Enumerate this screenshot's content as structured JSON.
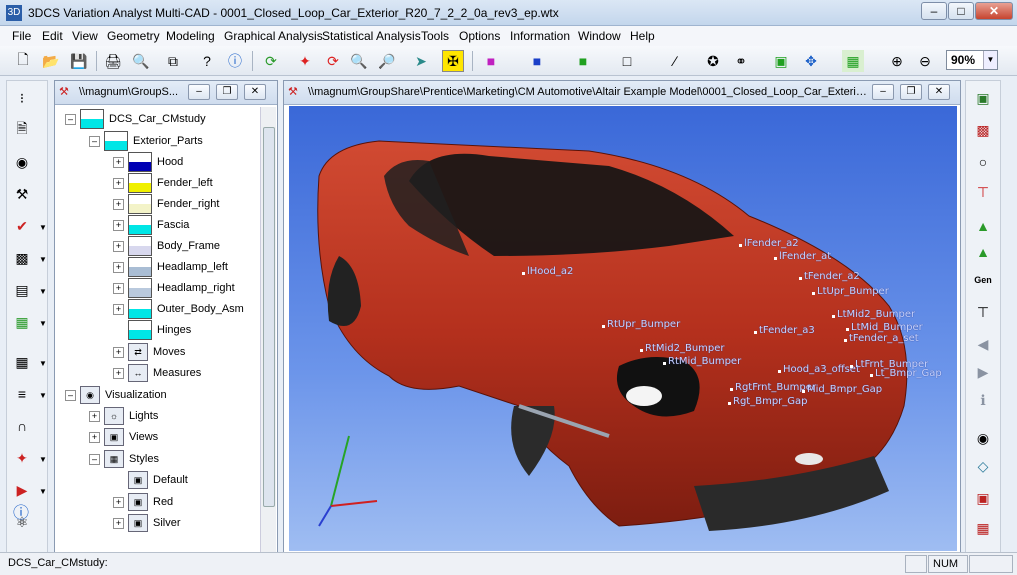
{
  "window": {
    "title": "3DCS Variation Analyst Multi-CAD - 0001_Closed_Loop_Car_Exterior_R20_7_2_2_0a_rev3_ep.wtx"
  },
  "menu": [
    "File",
    "Edit",
    "View",
    "Geometry",
    "Modeling",
    "Graphical Analysis",
    "Statistical Analysis",
    "Tools",
    "Options",
    "Information",
    "Window",
    "Help"
  ],
  "toolbar": {
    "zoom": "90%"
  },
  "tree_window": {
    "title": "\\\\magnum\\GroupS...",
    "root": "DCS_Car_CMstudy",
    "group": "Exterior_Parts",
    "parts": [
      {
        "label": "Hood",
        "color": "#0000b4"
      },
      {
        "label": "Fender_left",
        "color": "#f0f000"
      },
      {
        "label": "Fender_right",
        "color": "#f3f3c8"
      },
      {
        "label": "Fascia",
        "color": "#00e6e6"
      },
      {
        "label": "Body_Frame",
        "color": "#d8d8ee"
      },
      {
        "label": "Headlamp_left",
        "color": "#a9bdd4"
      },
      {
        "label": "Headlamp_right",
        "color": "#b9c9dd"
      },
      {
        "label": "Outer_Body_Asm",
        "color": "#00e6e6"
      },
      {
        "label": "Hinges",
        "color": "#00e6e6"
      }
    ],
    "folders": [
      {
        "label": "Moves"
      },
      {
        "label": "Measures"
      }
    ],
    "visualization": "Visualization",
    "vis_items": [
      {
        "label": "Lights"
      },
      {
        "label": "Views"
      },
      {
        "label": "Styles"
      }
    ],
    "styles": [
      {
        "label": "Default"
      },
      {
        "label": "Red"
      },
      {
        "label": "Silver"
      }
    ]
  },
  "view_window": {
    "title": "\\\\magnum\\GroupShare\\Prentice\\Marketing\\CM Automotive\\Altair Example Model\\0001_Closed_Loop_Car_Exterior_..."
  },
  "scene_labels": [
    "lHood_a2",
    "lFender_a2",
    "lFender_at",
    "tFender_a2",
    "RtUpr_Bumper",
    "LtUpr_Bumper",
    "tFender_a3",
    "LtMid2_Bumper",
    "LtMid_Bumper",
    "RtMid2_Bumper",
    "RtMid_Bumper",
    "Hood_a3_offset",
    "LtFrnt_Bumper",
    "RgtFrnt_Bumper",
    "Mid_Bmpr_Gap",
    "Lt_Bmpr_Gap",
    "Rgt_Bmpr_Gap",
    "tFender_a_set"
  ],
  "status": {
    "text": "DCS_Car_CMstudy:",
    "num": "NUM"
  },
  "colors": {
    "car": "#b8321f",
    "background_top": "#3a68d8",
    "background_bottom": "#9fbdf2",
    "label": "#c8d4ff"
  }
}
